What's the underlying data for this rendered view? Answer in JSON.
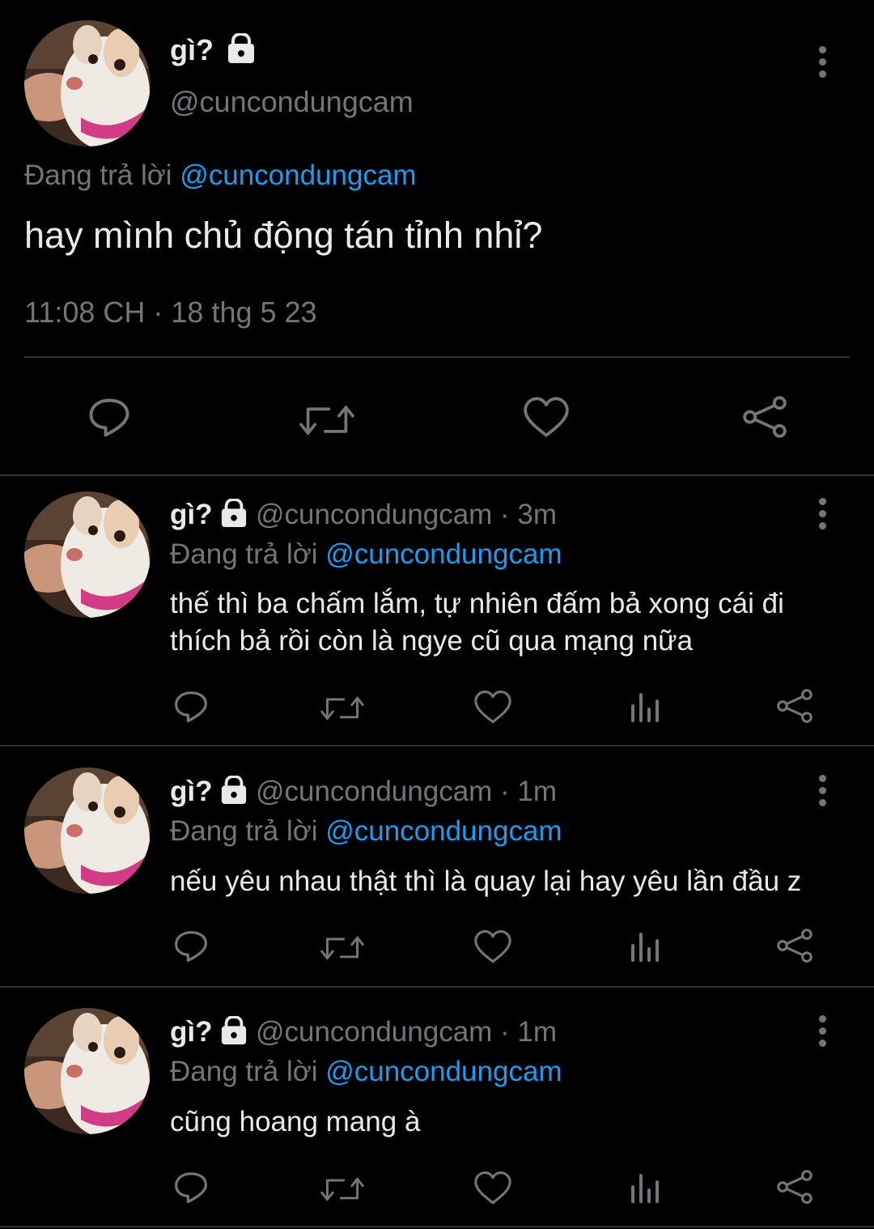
{
  "main_tweet": {
    "display_name": "gì?",
    "handle": "@cuncondungcam",
    "replying_prefix": "Đang trả lời",
    "replying_to": "@cuncondungcam",
    "text": "hay mình chủ động tán tỉnh nhỉ?",
    "timestamp": "11:08 CH · 18 thg 5 23",
    "actions": [
      "reply-icon",
      "retweet-icon",
      "like-icon",
      "share-icon"
    ]
  },
  "replies": [
    {
      "display_name": "gì?",
      "handle_time": "@cuncondungcam · 3m",
      "replying_prefix": "Đang trả lời",
      "replying_to": "@cuncondungcam",
      "text_line1": "thế thì ba chấm lắm, tự nhiên đấm bả xong cái đi",
      "text_line2": "thích bả rồi còn là ngye cũ qua mạng nữa"
    },
    {
      "display_name": "gì?",
      "handle_time": "@cuncondungcam · 1m",
      "replying_prefix": "Đang trả lời",
      "replying_to": "@cuncondungcam",
      "text_line1": "nếu yêu nhau thật thì là quay lại hay yêu lần đầu z"
    },
    {
      "display_name": "gì?",
      "handle_time": "@cuncondungcam · 1m",
      "replying_prefix": "Đang trả lời",
      "replying_to": "@cuncondungcam",
      "text_line1": "cũng hoang mang à"
    }
  ],
  "colors": {
    "background": "#000000",
    "text_primary": "#e7e9ea",
    "text_secondary": "#71767b",
    "link": "#1d9bf0",
    "divider": "#2f3336"
  }
}
